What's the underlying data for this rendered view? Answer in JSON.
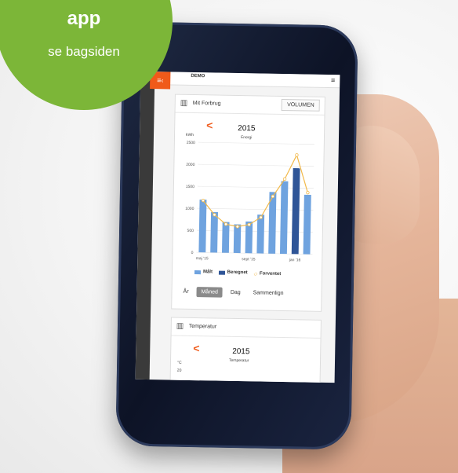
{
  "badge": {
    "line1": "app",
    "line2": "se bagsiden",
    "color": "#7cb638"
  },
  "app": {
    "menu_icon": "≡‹",
    "title": "DEMO",
    "hamburger_icon": "≡"
  },
  "consumption_card": {
    "icon": "bar-chart-icon",
    "title": "Mit Forbrug",
    "volume_button": "VOLUMEN",
    "nav_prev": "<",
    "year": "2015",
    "subtitle": "Energi",
    "unit": "kWh",
    "legend": {
      "measured": "Målt",
      "calculated": "Beregnet",
      "expected": "Forventet"
    },
    "tabs": [
      "År",
      "Måned",
      "Dag",
      "Sammenlign"
    ],
    "active_tab": "Måned"
  },
  "temperature_card": {
    "icon": "bar-chart-icon",
    "title": "Temperatur",
    "nav_prev": "<",
    "year": "2015",
    "subtitle": "Temperatur",
    "unit": "°C",
    "unit_value": "20"
  },
  "colors": {
    "accent": "#f05a1a",
    "measured": "#6fa3df",
    "calculated": "#2f5597",
    "expected": "#f2b94a"
  },
  "chart_data": {
    "type": "bar",
    "title": "2015",
    "subtitle": "Energi",
    "ylabel": "kWh",
    "ylim": [
      0,
      2500
    ],
    "yticks": [
      "0",
      "500",
      "1000",
      "1500",
      "2000",
      "2500"
    ],
    "x_tick_labels": [
      "maj '15",
      "sept '15",
      "jan '16"
    ],
    "series": [
      {
        "name": "Målt",
        "kind": "bar",
        "values": [
          1200,
          920,
          700,
          650,
          720,
          880,
          1400,
          1650,
          null,
          1350
        ]
      },
      {
        "name": "Beregnet",
        "kind": "bar",
        "values": [
          null,
          null,
          null,
          null,
          null,
          null,
          null,
          null,
          1950,
          null
        ]
      },
      {
        "name": "Forventet",
        "kind": "line",
        "values": [
          1180,
          860,
          650,
          600,
          650,
          820,
          1300,
          1700,
          2250,
          1400
        ]
      }
    ]
  }
}
